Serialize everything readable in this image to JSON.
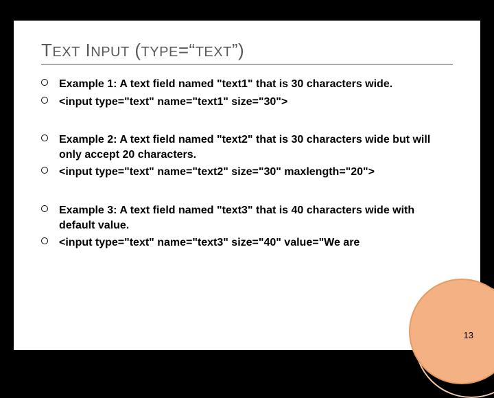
{
  "title": {
    "word1_big": "T",
    "word1_small": "EXT",
    "word2_big": " I",
    "word2_small": "NPUT",
    "paren_open": " (",
    "word3_small": "TYPE",
    "equals": "=“",
    "word4_small": "TEXT",
    "paren_close": "”)"
  },
  "bullets": [
    "Example 1: A text field named \"text1\" that is 30 characters wide.",
    "<input type=\"text\" name=\"text1\" size=\"30\">",
    "",
    "Example 2: A text field named \"text2\" that is 30 characters wide but will only accept 20 characters.",
    "<input type=\"text\" name=\"text2\" size=\"30\" maxlength=\"20\">",
    "",
    "Example 3: A text field named \"text3\" that is 40 characters wide with default value.",
    "<input type=\"text\" name=\"text3\" size=\"40\" value=\"We are"
  ],
  "page_number": "13"
}
